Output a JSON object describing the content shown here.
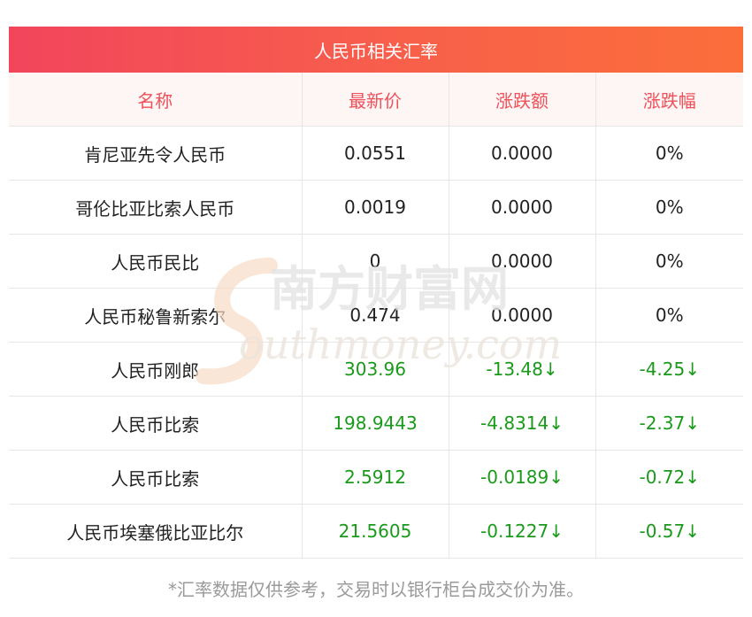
{
  "title": "人民币相关汇率",
  "headers": [
    "名称",
    "最新价",
    "涨跌额",
    "涨跌幅"
  ],
  "rows": [
    {
      "name": "肯尼亚先令人民币",
      "price": "0.0551",
      "change": "0.0000",
      "pct": "0%",
      "direction": "flat"
    },
    {
      "name": "哥伦比亚比索人民币",
      "price": "0.0019",
      "change": "0.0000",
      "pct": "0%",
      "direction": "flat"
    },
    {
      "name": "人民币民比",
      "price": "0",
      "change": "0.0000",
      "pct": "0%",
      "direction": "flat"
    },
    {
      "name": "人民币秘鲁新索尔",
      "price": "0.474",
      "change": "0.0000",
      "pct": "0%",
      "direction": "flat"
    },
    {
      "name": "人民币刚郎",
      "price": "303.96",
      "change": "-13.48↓",
      "pct": "-4.25↓",
      "direction": "down"
    },
    {
      "name": "人民币比索",
      "price": "198.9443",
      "change": "-4.8314↓",
      "pct": "-2.37↓",
      "direction": "down"
    },
    {
      "name": "人民币比索",
      "price": "2.5912",
      "change": "-0.0189↓",
      "pct": "-0.72↓",
      "direction": "down"
    },
    {
      "name": "人民币埃塞俄比亚比尔",
      "price": "21.5605",
      "change": "-0.1227↓",
      "pct": "-0.57↓",
      "direction": "down"
    }
  ],
  "footnote": "*汇率数据仅供参考，交易时以银行柜台成交价为准。",
  "watermark": {
    "cn": "南方财富网",
    "en": "outhmoney.com"
  },
  "colors": {
    "accent": "#f2455c",
    "header_text": "#f0505a",
    "down": "#1a9a1a"
  }
}
